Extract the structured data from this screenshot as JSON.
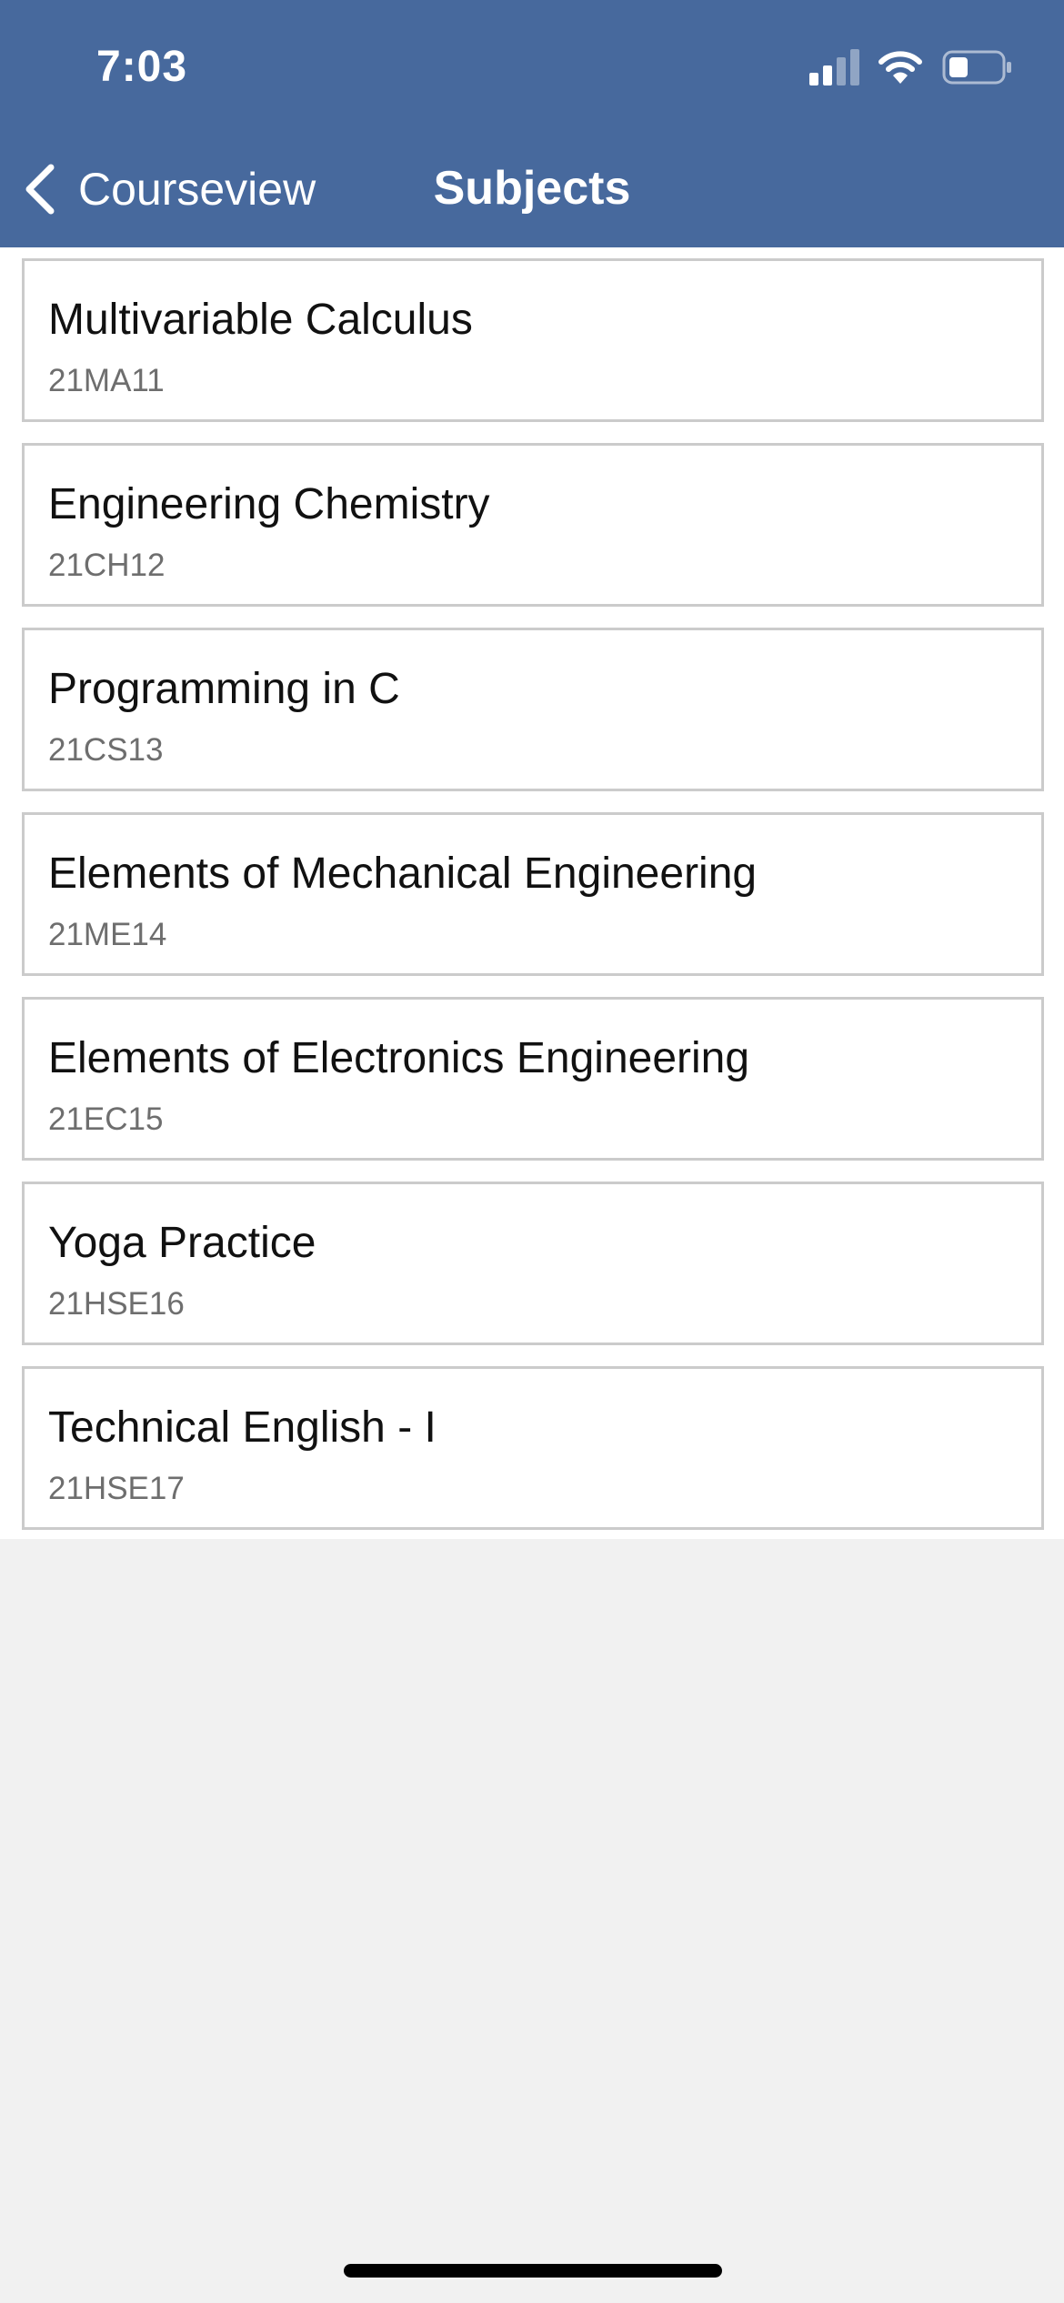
{
  "status_bar": {
    "time": "7:03",
    "signal_icon": "cellular-signal-icon",
    "wifi_icon": "wifi-icon",
    "battery_icon": "battery-icon"
  },
  "nav": {
    "back_label": "Courseview",
    "back_icon": "chevron-left-icon",
    "title": "Subjects"
  },
  "colors": {
    "header_bg": "#47699d",
    "list_bg": "#ffffff",
    "page_bg": "#f1f1f1",
    "card_border": "#cbcbcb",
    "code_text": "#6e6e6e"
  },
  "subjects": [
    {
      "name": "Multivariable Calculus",
      "code": "21MA11"
    },
    {
      "name": "Engineering Chemistry",
      "code": "21CH12"
    },
    {
      "name": "Programming in C",
      "code": "21CS13"
    },
    {
      "name": "Elements of Mechanical Engineering",
      "code": "21ME14"
    },
    {
      "name": "Elements of Electronics Engineering",
      "code": "21EC15"
    },
    {
      "name": "Yoga Practice",
      "code": "21HSE16"
    },
    {
      "name": "Technical English - I",
      "code": "21HSE17"
    }
  ]
}
